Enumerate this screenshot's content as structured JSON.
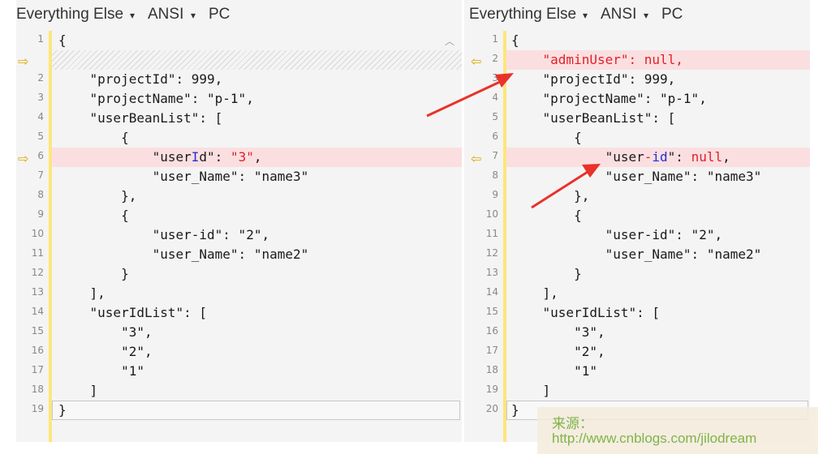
{
  "left": {
    "header": {
      "encoding": "Everything Else",
      "charset": "ANSI",
      "eol": "PC"
    },
    "scroll_up_icon": "chevron-up-icon",
    "lines": [
      {
        "n": "1",
        "text": "{"
      },
      {
        "n": "",
        "text": "",
        "placeholder": true,
        "marker": "⇨"
      },
      {
        "n": "2",
        "text": "    \"projectId\": 999,"
      },
      {
        "n": "3",
        "text": "    \"projectName\": \"p-1\","
      },
      {
        "n": "4",
        "text": "    \"userBeanList\": ["
      },
      {
        "n": "5",
        "text": "        {"
      },
      {
        "n": "6",
        "text": "            \"userId\": \"3\",",
        "diff": true,
        "marker": "⇨"
      },
      {
        "n": "7",
        "text": "            \"user_Name\": \"name3\""
      },
      {
        "n": "8",
        "text": "        },"
      },
      {
        "n": "9",
        "text": "        {"
      },
      {
        "n": "10",
        "text": "            \"user-id\": \"2\","
      },
      {
        "n": "11",
        "text": "            \"user_Name\": \"name2\""
      },
      {
        "n": "12",
        "text": "        }"
      },
      {
        "n": "13",
        "text": "    ],"
      },
      {
        "n": "14",
        "text": "    \"userIdList\": ["
      },
      {
        "n": "15",
        "text": "        \"3\","
      },
      {
        "n": "16",
        "text": "        \"2\","
      },
      {
        "n": "17",
        "text": "        \"1\""
      },
      {
        "n": "18",
        "text": "    ]"
      },
      {
        "n": "19",
        "text": "}",
        "cursor": true
      }
    ]
  },
  "right": {
    "header": {
      "encoding": "Everything Else",
      "charset": "ANSI",
      "eol": "PC"
    },
    "lines": [
      {
        "n": "1",
        "text": "{"
      },
      {
        "n": "2",
        "text": "    \"adminUser\": null,",
        "diff": true,
        "marker": "⇦",
        "allred": true
      },
      {
        "n": "3",
        "text": "    \"projectId\": 999,"
      },
      {
        "n": "4",
        "text": "    \"projectName\": \"p-1\","
      },
      {
        "n": "5",
        "text": "    \"userBeanList\": ["
      },
      {
        "n": "6",
        "text": "        {"
      },
      {
        "n": "7",
        "text": "            \"user-id\": null,",
        "diff": true,
        "marker": "⇦"
      },
      {
        "n": "8",
        "text": "            \"user_Name\": \"name3\""
      },
      {
        "n": "9",
        "text": "        },"
      },
      {
        "n": "10",
        "text": "        {"
      },
      {
        "n": "11",
        "text": "            \"user-id\": \"2\","
      },
      {
        "n": "12",
        "text": "            \"user_Name\": \"name2\""
      },
      {
        "n": "13",
        "text": "        }"
      },
      {
        "n": "14",
        "text": "    ],"
      },
      {
        "n": "15",
        "text": "    \"userIdList\": ["
      },
      {
        "n": "16",
        "text": "        \"3\","
      },
      {
        "n": "17",
        "text": "        \"2\","
      },
      {
        "n": "18",
        "text": "        \"1\""
      },
      {
        "n": "19",
        "text": "    ]"
      },
      {
        "n": "20",
        "text": "}",
        "cursor": true
      }
    ]
  },
  "watermark": {
    "label": "来源：",
    "url": "http://www.cnblogs.com/jilodream"
  },
  "colors": {
    "diff_bg": "#fbdfe0",
    "gutter": "#ffe57a",
    "diff_text": "#e0202a",
    "highlight_text": "#2030d8",
    "annotation_arrow": "#e8322a"
  }
}
